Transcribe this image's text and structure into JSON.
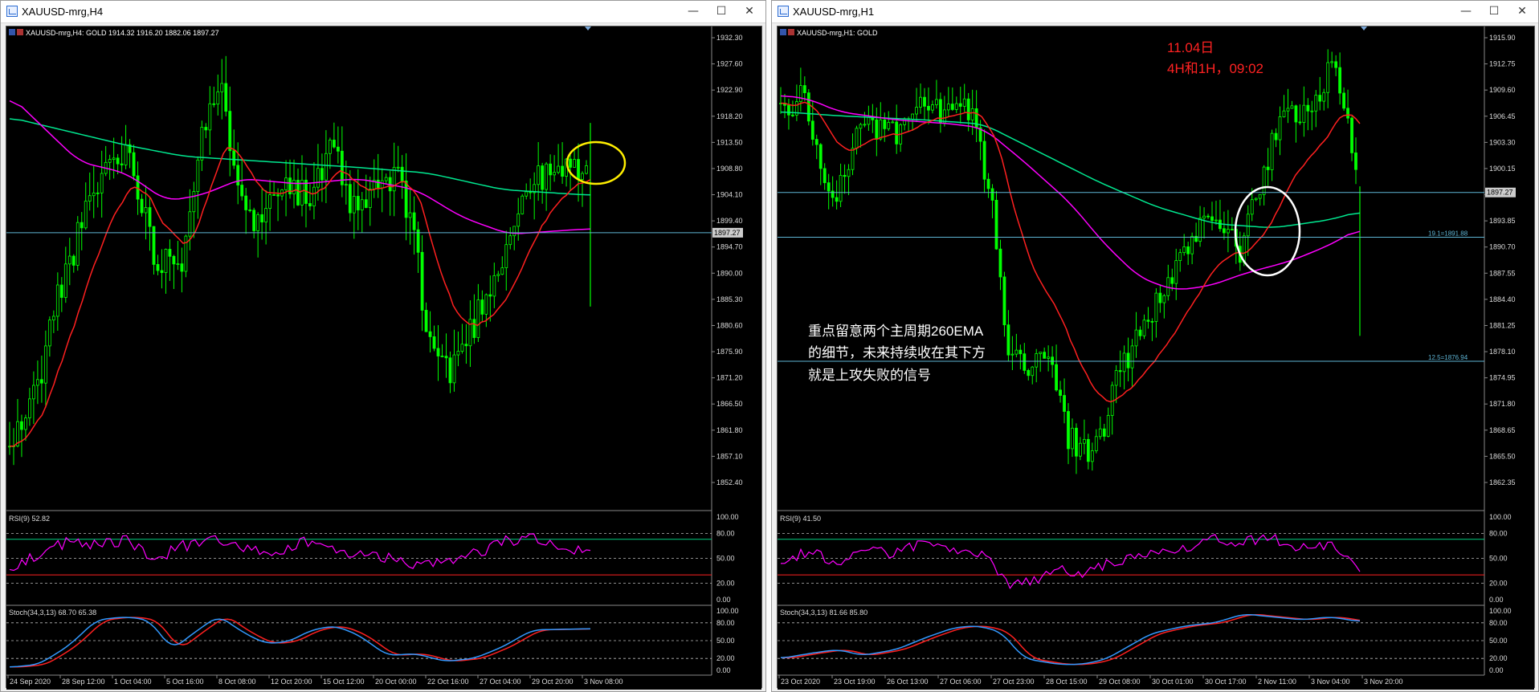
{
  "windows": [
    {
      "title": "XAUUSD-mrg,H4",
      "controls": {
        "minimize": "—",
        "maximize": "☐",
        "close": "✕"
      },
      "header": "XAUUSD-mrg,H4:  GOLD  1914.32 1916.20 1882.06 1897.27",
      "price_labels": [
        "1932.30",
        "1927.60",
        "1922.90",
        "1918.20",
        "1913.50",
        "1908.80",
        "1904.10",
        "1899.40",
        "1894.70",
        "1890.00",
        "1885.30",
        "1880.60",
        "1875.90",
        "1871.20",
        "1866.50",
        "1861.80",
        "1857.10",
        "1852.40"
      ],
      "current_price": "1897.27",
      "rsi_label": "RSI(9) 52.82",
      "rsi_levels": [
        "100.00",
        "80.00",
        "50.00",
        "20.00",
        "0.00"
      ],
      "stoch_label": "Stoch(34,3,13) 68.70 65.38",
      "stoch_levels": [
        "100.00",
        "80.00",
        "50.00",
        "20.00",
        "0.00"
      ],
      "time_labels": [
        "24 Sep 2020",
        "28 Sep 12:00",
        "1 Oct 04:00",
        "5 Oct 16:00",
        "8 Oct 08:00",
        "12 Oct 20:00",
        "15 Oct 12:00",
        "20 Oct 00:00",
        "22 Oct 16:00",
        "27 Oct 04:00",
        "29 Oct 20:00",
        "3 Nov 08:00"
      ],
      "annotation_circle_color": "#ffee00",
      "annotations": []
    },
    {
      "title": "XAUUSD-mrg,H1",
      "controls": {
        "minimize": "—",
        "maximize": "☐",
        "close": "✕"
      },
      "header": "XAUUSD-mrg,H1:  GOLD",
      "price_labels": [
        "1915.90",
        "1912.75",
        "1909.60",
        "1906.45",
        "1903.30",
        "1900.15",
        "1897.00",
        "1893.85",
        "1890.70",
        "1887.55",
        "1884.40",
        "1881.25",
        "1878.10",
        "1874.95",
        "1871.80",
        "1868.65",
        "1865.50",
        "1862.35"
      ],
      "current_price": "1897.27",
      "fib_labels": [
        "19.1=1891.88",
        "12.5=1876.94"
      ],
      "rsi_label": "RSI(9) 41.50",
      "rsi_levels": [
        "100.00",
        "80.00",
        "50.00",
        "20.00",
        "0.00"
      ],
      "stoch_label": "Stoch(34,3,13) 81.66 85.80",
      "stoch_levels": [
        "100.00",
        "80.00",
        "50.00",
        "20.00",
        "0.00"
      ],
      "time_labels": [
        "23 Oct 2020",
        "23 Oct 19:00",
        "26 Oct 13:00",
        "27 Oct 06:00",
        "27 Oct 23:00",
        "28 Oct 15:00",
        "29 Oct 08:00",
        "30 Oct 01:00",
        "30 Oct 17:00",
        "2 Nov 11:00",
        "3 Nov 04:00",
        "3 Nov 20:00"
      ],
      "annotation_circle_color": "#ffffff",
      "annotations": [
        {
          "text": "11.04日",
          "color": "#ff2222"
        },
        {
          "text": "4H和1H，09:02",
          "color": "#ff2222"
        },
        {
          "text": "重点留意两个主周期260EMA",
          "color": "#ffffff"
        },
        {
          "text": "的细节，未来持续收在其下方",
          "color": "#ffffff"
        },
        {
          "text": "就是上攻失败的信号",
          "color": "#ffffff"
        }
      ]
    }
  ],
  "colors": {
    "candle": "#00ff00",
    "ema_red": "#ff2020",
    "ema_magenta": "#ff00ff",
    "ema_green": "#00e890",
    "hline": "#5fb6d6",
    "rsi": "#ff00ff",
    "stoch_main": "#3399ff",
    "stoch_signal": "#ff2020"
  },
  "icons": {
    "window": "chart-window-icon",
    "marker": "triangle-marker-icon"
  }
}
